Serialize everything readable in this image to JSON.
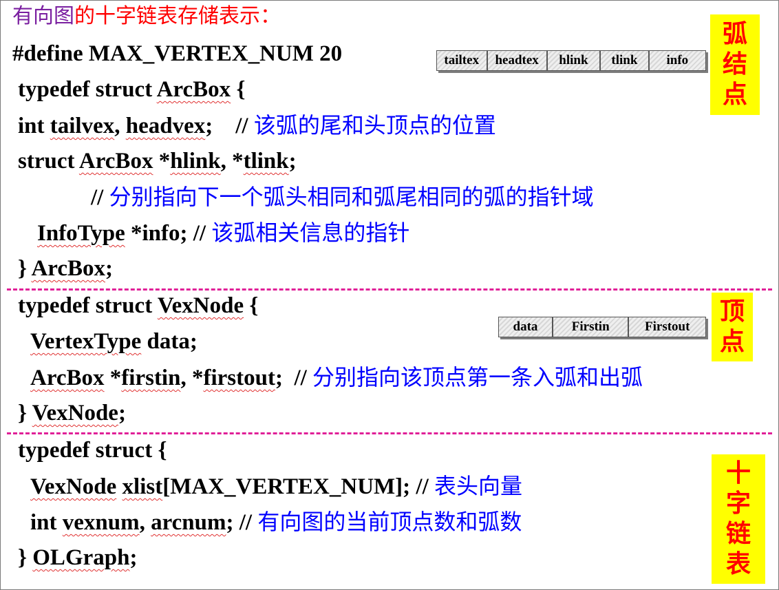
{
  "title": {
    "part1": "有向图",
    "part2": "的十字链表存储表示："
  },
  "define_line": "#define MAX_VERTEX_NUM 20",
  "arcbox": {
    "open_a": "typedef struct ",
    "open_b": "ArcBox",
    "open_c": " {",
    "vex_a": "int ",
    "vex_b": "tailvex",
    "vex_c": ", ",
    "vex_d": "headvex",
    "vex_e": ";    // ",
    "vex_comment": "该弧的尾和头顶点的位置",
    "link_a": "struct ",
    "link_b": "ArcBox",
    "link_c": " *",
    "link_d": "hlink",
    "link_e": ", *",
    "link_f": "tlink",
    "link_g": ";",
    "link_comment_prefix": "// ",
    "link_comment": "分别指向下一个弧头相同和弧尾相同的弧的指针域",
    "info_a": "InfoType",
    "info_b": " *info; // ",
    "info_comment": "该弧相关信息的指针",
    "close_a": "} ",
    "close_b": "ArcBox",
    "close_c": ";"
  },
  "vexnode": {
    "open_a": "typedef struct ",
    "open_b": "VexNode",
    "open_c": " {",
    "data_a": "VertexType",
    "data_b": " data;",
    "first_a": "ArcBox",
    "first_b": " *",
    "first_c": "firstin",
    "first_d": ", *",
    "first_e": "firstout",
    "first_f": ";  // ",
    "first_comment": "分别指向该顶点第一条入弧和出弧",
    "close_a": "} ",
    "close_b": "VexNode",
    "close_c": ";"
  },
  "olgraph": {
    "open": "typedef struct {",
    "xlist_a": "VexNode",
    "xlist_b": " ",
    "xlist_c": "xlist",
    "xlist_d": "[MAX_VERTEX_NUM]; // ",
    "xlist_comment": "表头向量",
    "num_a": "int ",
    "num_b": "vexnum",
    "num_c": ", ",
    "num_d": "arcnum",
    "num_e": "; // ",
    "num_comment": "有向图的当前顶点数和弧数",
    "close_a": "} ",
    "close_b": "OLGraph",
    "close_c": ";"
  },
  "arc_node_fields": [
    "tailtex",
    "headtex",
    "hlink",
    "tlink",
    "info"
  ],
  "vertex_fields": [
    "data",
    "Firstin",
    "Firstout"
  ],
  "tags": {
    "arc_node": [
      "弧",
      "结",
      "点"
    ],
    "vertex": [
      "顶",
      "点"
    ],
    "cross_list": [
      "十",
      "字",
      "链",
      "表"
    ]
  },
  "colors": {
    "comment": "#0000ff",
    "title_a": "#7a1fa0",
    "title_b": "#ff0000",
    "tag_bg": "#ffff00",
    "tag_text": "#ff0000",
    "divider": "#e02098"
  }
}
